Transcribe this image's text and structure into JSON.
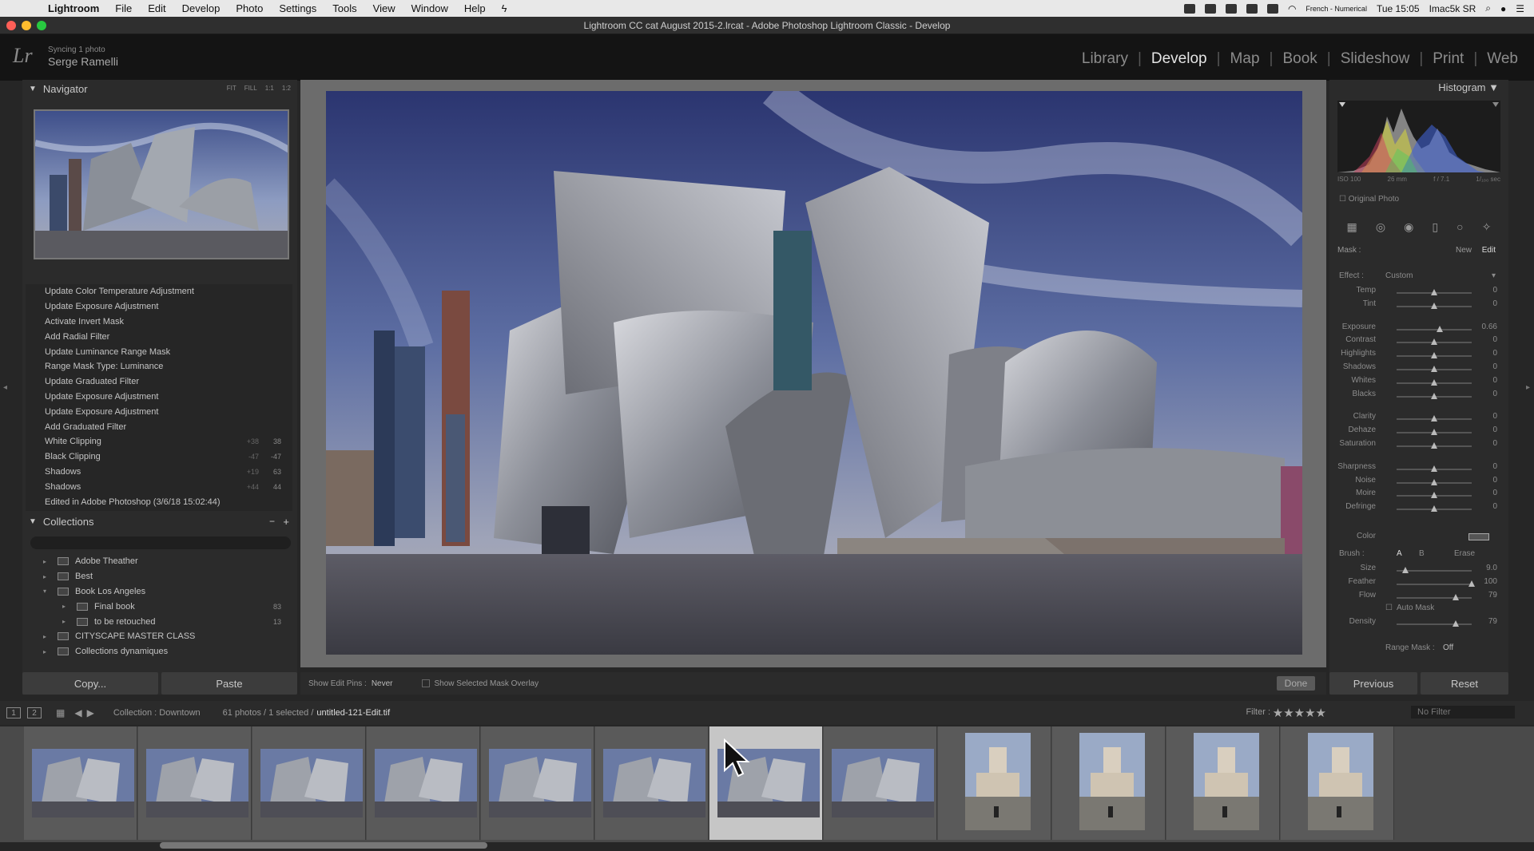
{
  "menubar": {
    "app": "Lightroom",
    "items": [
      "File",
      "Edit",
      "Develop",
      "Photo",
      "Settings",
      "Tools",
      "View",
      "Window",
      "Help"
    ],
    "status_lang": "French - Numerical",
    "clock": "Tue 15:05",
    "machine": "Imac5k SR"
  },
  "window_title": "Lightroom CC cat August 2015-2.lrcat - Adobe Photoshop Lightroom Classic - Develop",
  "identity": {
    "logo": "Lr",
    "sync": "Syncing 1 photo",
    "user": "Serge Ramelli"
  },
  "modules": [
    "Library",
    "Develop",
    "Map",
    "Book",
    "Slideshow",
    "Print",
    "Web"
  ],
  "active_module": "Develop",
  "navigator": {
    "title": "Navigator",
    "zoom": [
      "FIT",
      "FILL",
      "1:1",
      "1:2"
    ]
  },
  "history": [
    {
      "label": "Update Color Temperature Adjustment"
    },
    {
      "label": "Update Exposure Adjustment"
    },
    {
      "label": "Activate Invert Mask"
    },
    {
      "label": "Add Radial Filter"
    },
    {
      "label": "Update Luminance Range Mask"
    },
    {
      "label": "Range Mask Type: Luminance"
    },
    {
      "label": "Update Graduated Filter"
    },
    {
      "label": "Update Exposure Adjustment"
    },
    {
      "label": "Update Exposure Adjustment"
    },
    {
      "label": "Add Graduated Filter"
    },
    {
      "label": "White Clipping",
      "a": "+38",
      "b": "38"
    },
    {
      "label": "Black Clipping",
      "a": "-47",
      "b": "-47"
    },
    {
      "label": "Shadows",
      "a": "+19",
      "b": "63"
    },
    {
      "label": "Shadows",
      "a": "+44",
      "b": "44"
    },
    {
      "label": "Edited in Adobe Photoshop (3/6/18 15:02:44)"
    }
  ],
  "collections": {
    "title": "Collections",
    "items": [
      {
        "label": "Adobe Theather",
        "indent": 0,
        "tri": "▸",
        "count": ""
      },
      {
        "label": "Best",
        "indent": 0,
        "tri": "▸",
        "count": ""
      },
      {
        "label": "Book Los Angeles",
        "indent": 0,
        "tri": "▾",
        "count": ""
      },
      {
        "label": "Final book",
        "indent": 1,
        "tri": "▸",
        "count": "83"
      },
      {
        "label": "to be retouched",
        "indent": 1,
        "tri": "▸",
        "count": "13"
      },
      {
        "label": "CITYSCAPE MASTER CLASS",
        "indent": 0,
        "tri": "▸",
        "count": ""
      },
      {
        "label": "Collections dynamiques",
        "indent": 0,
        "tri": "▸",
        "count": ""
      }
    ]
  },
  "left_buttons": {
    "copy": "Copy...",
    "paste": "Paste"
  },
  "toolbar": {
    "show_pins": "Show Edit Pins :",
    "pins_value": "Never",
    "overlay": "Show Selected Mask Overlay",
    "done": "Done"
  },
  "histogram": {
    "title": "Histogram",
    "iso": "ISO 100",
    "focal": "26 mm",
    "aperture": "f / 7.1",
    "shutter": "1/₁₀₀ sec",
    "original": "Original Photo"
  },
  "mask": {
    "label": "Mask :",
    "new": "New",
    "edit": "Edit"
  },
  "effect": {
    "label": "Effect :",
    "value": "Custom"
  },
  "sliders": [
    {
      "name": "Temp",
      "value": "0",
      "pos": 0.5
    },
    {
      "name": "Tint",
      "value": "0",
      "pos": 0.5
    },
    {
      "name": "Exposure",
      "value": "0.66",
      "pos": 0.57
    },
    {
      "name": "Contrast",
      "value": "0",
      "pos": 0.5
    },
    {
      "name": "Highlights",
      "value": "0",
      "pos": 0.5
    },
    {
      "name": "Shadows",
      "value": "0",
      "pos": 0.5
    },
    {
      "name": "Whites",
      "value": "0",
      "pos": 0.5
    },
    {
      "name": "Blacks",
      "value": "0",
      "pos": 0.5
    },
    {
      "name": "Clarity",
      "value": "0",
      "pos": 0.5
    },
    {
      "name": "Dehaze",
      "value": "0",
      "pos": 0.5
    },
    {
      "name": "Saturation",
      "value": "0",
      "pos": 0.5
    },
    {
      "name": "Sharpness",
      "value": "0",
      "pos": 0.5
    },
    {
      "name": "Noise",
      "value": "0",
      "pos": 0.5
    },
    {
      "name": "Moire",
      "value": "0",
      "pos": 0.5
    },
    {
      "name": "Defringe",
      "value": "0",
      "pos": 0.5
    }
  ],
  "color_label": "Color",
  "brush": {
    "label": "Brush :",
    "a": "A",
    "b": "B",
    "erase": "Erase",
    "size": {
      "name": "Size",
      "value": "9.0",
      "pos": 0.12
    },
    "feather": {
      "name": "Feather",
      "value": "100",
      "pos": 1.0
    },
    "flow": {
      "name": "Flow",
      "value": "79",
      "pos": 0.79
    },
    "automask": "Auto Mask",
    "density": {
      "name": "Density",
      "value": "79",
      "pos": 0.79
    }
  },
  "range_mask": {
    "label": "Range Mask :",
    "value": "Off"
  },
  "right_buttons": {
    "previous": "Previous",
    "reset": "Reset"
  },
  "filmstrip": {
    "page1": "1",
    "page2": "2",
    "collection": "Collection : Downtown",
    "count": "61 photos / 1 selected /",
    "filename": "untitled-121-Edit.tif",
    "filter": "Filter :",
    "nofilter": "No Filter",
    "selected_index": 6
  }
}
